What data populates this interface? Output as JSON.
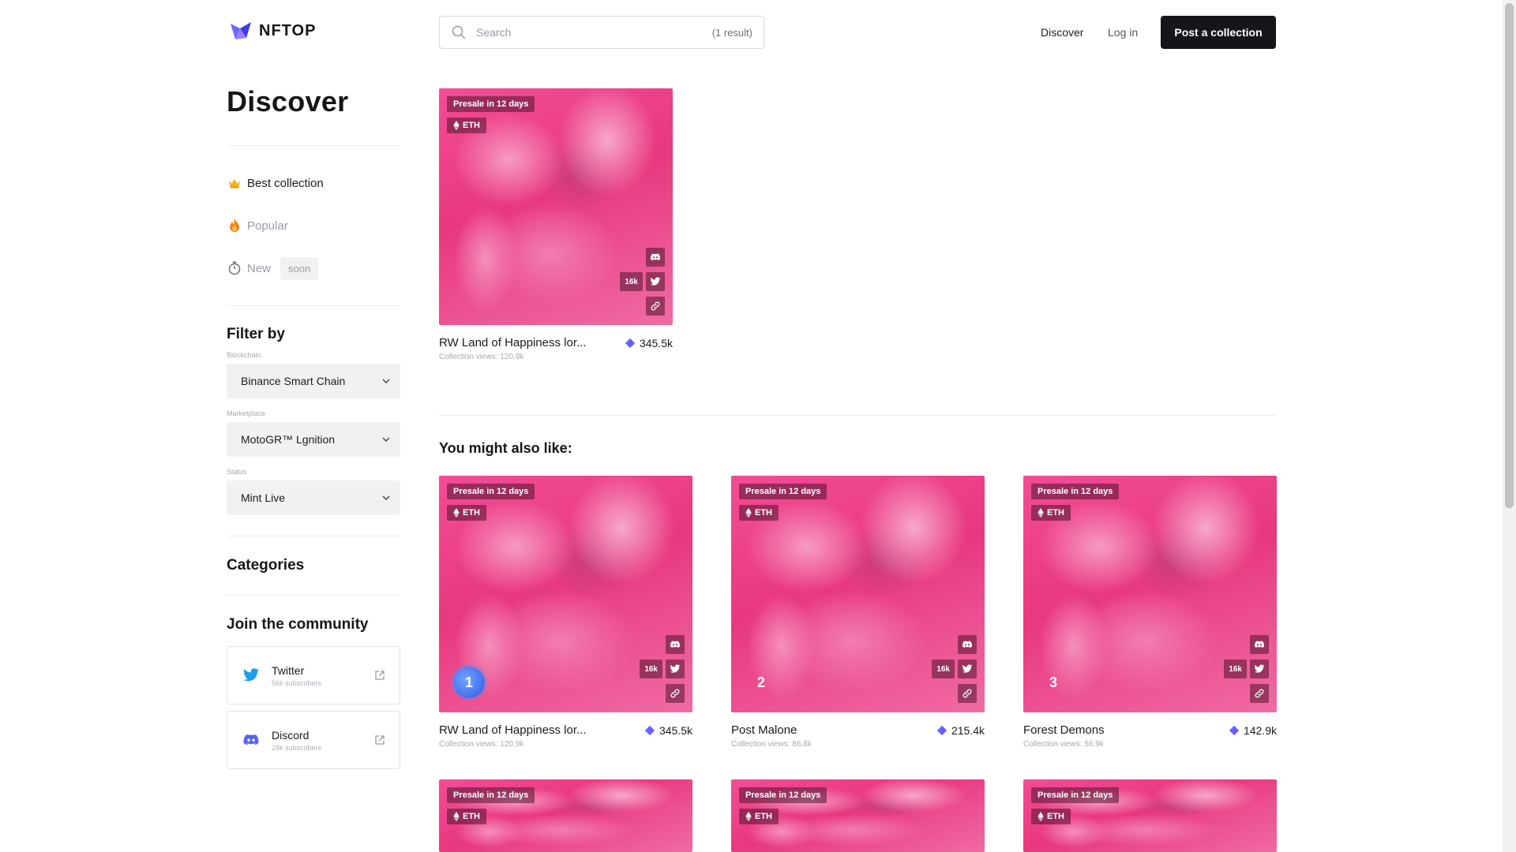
{
  "header": {
    "logo_text": "NFTOP",
    "search_placeholder": "Search",
    "search_count": "(1 result)",
    "nav_discover": "Discover",
    "nav_login": "Log in",
    "post_button": "Post a collection"
  },
  "sidebar": {
    "title": "Discover",
    "nav": [
      {
        "label": "Best collection",
        "icon": "crown-icon"
      },
      {
        "label": "Popular",
        "icon": "fire-icon"
      },
      {
        "label": "New",
        "icon": "stopwatch-icon",
        "tag": "soon"
      }
    ],
    "filter_title": "Filter by",
    "filters": [
      {
        "label": "Blockchain",
        "value": "Binance Smart Chain"
      },
      {
        "label": "Marketplace",
        "value": "MotoGR™ Lgnition"
      },
      {
        "label": "Status",
        "value": "Mint Live"
      }
    ],
    "categories_title": "Categories",
    "community_title": "Join the community",
    "community": [
      {
        "name": "Twitter",
        "subs": "56k subscribers",
        "icon": "twitter-icon"
      },
      {
        "name": "Discord",
        "subs": "28k subscribers",
        "icon": "discord-icon"
      }
    ]
  },
  "result_card": {
    "presale": "Presale in 12 days",
    "chain": "ETH",
    "twitter_count": "16k",
    "name": "RW Land of Happiness lor...",
    "value": "345.5k",
    "views": "Collection views: 120.9k"
  },
  "also_title": "You might also like:",
  "recommended": [
    {
      "rank": "1",
      "presale": "Presale in 12 days",
      "chain": "ETH",
      "twitter_count": "16k",
      "name": "RW Land of Happiness lor...",
      "value": "345.5k",
      "views": "Collection views: 120.9k"
    },
    {
      "rank": "2",
      "presale": "Presale in 12 days",
      "chain": "ETH",
      "twitter_count": "16k",
      "name": "Post Malone",
      "value": "215.4k",
      "views": "Collection views: 86.8k"
    },
    {
      "rank": "3",
      "presale": "Presale in 12 days",
      "chain": "ETH",
      "twitter_count": "16k",
      "name": "Forest Demons",
      "value": "142.9k",
      "views": "Collection views: 56.9k"
    },
    {
      "presale": "Presale in 12 days",
      "chain": "ETH"
    },
    {
      "presale": "Presale in 12 days",
      "chain": "ETH"
    },
    {
      "presale": "Presale in 12 days",
      "chain": "ETH"
    }
  ],
  "colors": {
    "accent": "#16161a",
    "card_pink": "#e8387f",
    "rank_blue": "#2e56e0"
  }
}
